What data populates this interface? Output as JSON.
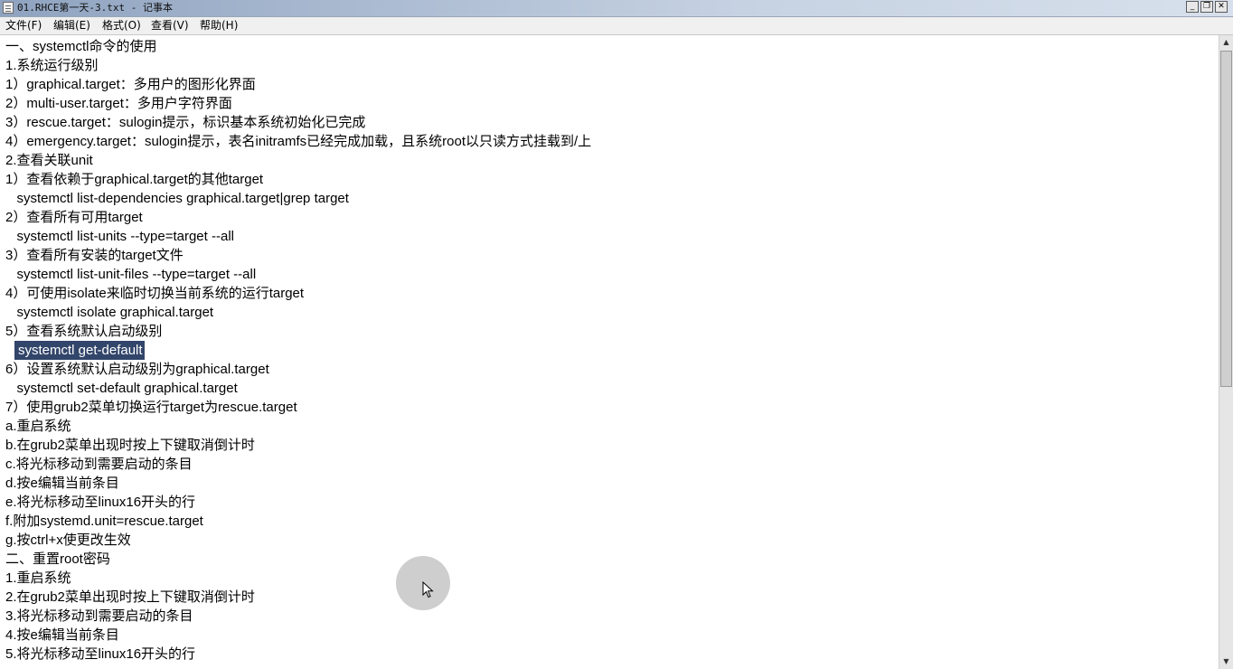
{
  "window": {
    "title": "01.RHCE第一天-3.txt - 记事本",
    "buttons": {
      "minimize": "_",
      "restore": "❐",
      "close": "✕"
    }
  },
  "menu": [
    "文件(F)",
    "编辑(E)",
    "格式(O)",
    "查看(V)",
    "帮助(H)"
  ],
  "document": {
    "lines": [
      "一、systemctl命令的使用",
      "1.系统运行级别",
      "1）graphical.target：多用户的图形化界面",
      "2）multi-user.target：多用户字符界面",
      "3）rescue.target：sulogin提示，标识基本系统初始化已完成",
      "4）emergency.target：sulogin提示，表名initramfs已经完成加载，且系统root以只读方式挂载到/上",
      "2.查看关联unit",
      "1）查看依赖于graphical.target的其他target",
      "   systemctl list-dependencies graphical.target|grep target",
      "2）查看所有可用target",
      "   systemctl list-units --type=target --all",
      "3）查看所有安装的target文件",
      "   systemctl list-unit-files --type=target --all",
      "4）可使用isolate来临时切换当前系统的运行target",
      "   systemctl isolate graphical.target",
      "5）查看系统默认启动级别",
      "systemctl get-default",
      "6）设置系统默认启动级别为graphical.target",
      "   systemctl set-default graphical.target",
      "7）使用grub2菜单切换运行target为rescue.target",
      "a.重启系统",
      "b.在grub2菜单出现时按上下键取消倒计时",
      "c.将光标移动到需要启动的条目",
      "d.按e编辑当前条目",
      "e.将光标移动至linux16开头的行",
      "f.附加systemd.unit=rescue.target",
      "g.按ctrl+x使更改生效",
      "二、重置root密码",
      "1.重启系统",
      "2.在grub2菜单出现时按上下键取消倒计时",
      "3.将光标移动到需要启动的条目",
      "4.按e编辑当前条目",
      "5.将光标移动至linux16开头的行"
    ],
    "selected_line_index": 16
  },
  "colors": {
    "selection_bg": "#32456a",
    "selection_fg": "#ffffff"
  },
  "icons": {
    "app": "notepad-icon",
    "pointer": "mouse-pointer-icon",
    "scroll_up": "triangle-up-icon",
    "scroll_down": "triangle-down-icon"
  }
}
